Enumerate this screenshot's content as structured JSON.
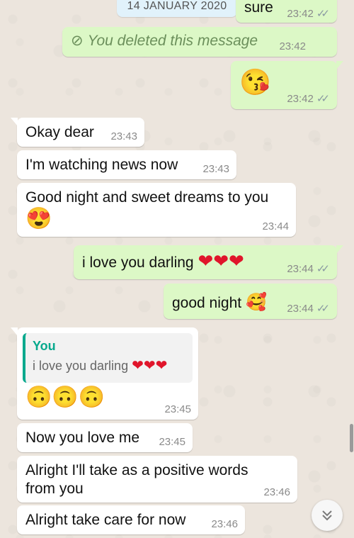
{
  "date_chip": "14 JANUARY 2020",
  "messages": [
    {
      "dir": "out",
      "text": "sure",
      "time": "23:42",
      "status": "read"
    },
    {
      "dir": "out",
      "text": "You deleted this message",
      "time": "23:42",
      "deleted": true
    },
    {
      "dir": "out",
      "emoji": "😘",
      "time": "23:42",
      "status": "read"
    },
    {
      "dir": "in",
      "text": "Okay dear",
      "time": "23:43"
    },
    {
      "dir": "in",
      "text": "I'm watching news now",
      "time": "23:43"
    },
    {
      "dir": "in",
      "text": "Good night and sweet dreams to you",
      "emoji": "😍",
      "time": "23:44"
    },
    {
      "dir": "out",
      "text": "i love you darling",
      "hearts": "❤❤❤",
      "time": "23:44",
      "status": "read"
    },
    {
      "dir": "out",
      "text": "good night",
      "emoji": "🥰",
      "time": "23:44",
      "status": "read"
    },
    {
      "dir": "in",
      "quote_author": "You",
      "quote_text": "i love you darling",
      "quote_hearts": "❤❤❤",
      "emoji": "🙃🙃🙃",
      "time": "23:45"
    },
    {
      "dir": "in",
      "text": "Now you love me",
      "time": "23:45"
    },
    {
      "dir": "in",
      "text_line1": "Alright I'll take as a positive words",
      "text_line2": "from you",
      "time": "23:46"
    },
    {
      "dir": "in",
      "text": "Alright take care for now",
      "time": "23:46"
    }
  ],
  "icons": {
    "read_ticks": "double-check-icon",
    "deleted": "block-icon",
    "scroll_down": "chevron-double-down-icon"
  },
  "colors": {
    "incoming": "#ffffff",
    "outgoing": "#dcf8c6",
    "background": "#ece5dd",
    "quote_accent": "#06a98d"
  }
}
